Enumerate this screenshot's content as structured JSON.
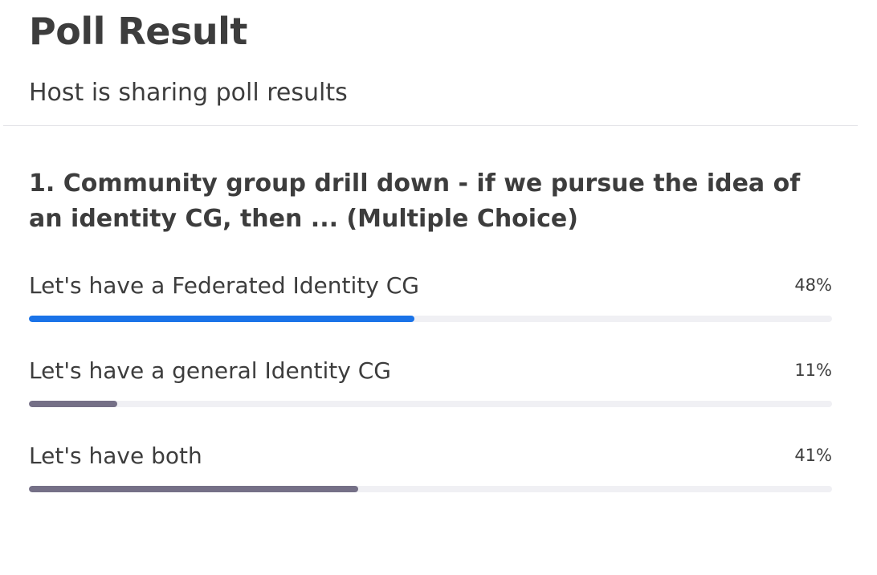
{
  "header": {
    "title": "Poll Result",
    "subtitle": "Host is sharing poll results"
  },
  "poll": {
    "question": "1. Community group drill down - if we pursue the idea of an identity CG, then ... (Multiple Choice)",
    "options": [
      {
        "label": "Let's have a Federated Identity CG",
        "percent_text": "48%",
        "percent": 48,
        "color": "#1a73e8"
      },
      {
        "label": "Let's have a general Identity CG",
        "percent_text": "11%",
        "percent": 11,
        "color": "#757087"
      },
      {
        "label": "Let's have both",
        "percent_text": "41%",
        "percent": 41,
        "color": "#757087"
      }
    ]
  },
  "colors": {
    "track": "#f0f0f4",
    "highlight": "#1a73e8",
    "neutral_bar": "#757087"
  }
}
